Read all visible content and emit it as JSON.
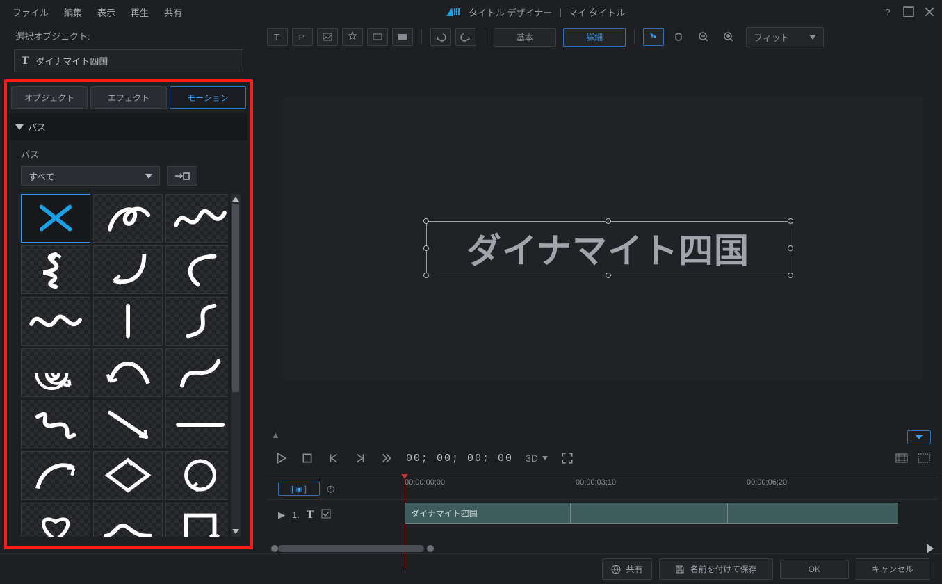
{
  "menu": {
    "file": "ファイル",
    "edit": "編集",
    "view": "表示",
    "play": "再生",
    "share": "共有"
  },
  "title": {
    "app": "タイトル デザイナー",
    "sep": "|",
    "doc": "マイ タイトル"
  },
  "sel_obj_label": "選択オブジェクト:",
  "sel_obj_value": "ダイナマイト四国",
  "tabs": {
    "object": "オブジェクト",
    "effect": "エフェクト",
    "motion": "モーション"
  },
  "section_path": "パス",
  "path_label": "パス",
  "path_filter": "すべて",
  "toolbar": {
    "basic": "基本",
    "detail": "詳細",
    "fit": "フィット"
  },
  "canvas_text": "ダイナマイト四国",
  "timecode": "00; 00; 00; 00",
  "threeD": "3D",
  "ruler": {
    "t0": "00;00;00;00",
    "t1": "00;00;03;10",
    "t2": "00;00;06;20"
  },
  "track": {
    "idx": "1.",
    "clip_label": "ダイナマイト四国"
  },
  "footer": {
    "share": "共有",
    "save_as": "名前を付けて保存",
    "ok": "OK",
    "cancel": "キャンセル"
  }
}
